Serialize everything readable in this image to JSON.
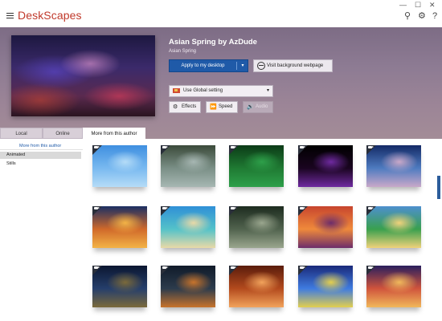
{
  "app": {
    "title": "DeskScapes",
    "window_controls": {
      "minimize": "—",
      "maximize": "☐",
      "close": "✕"
    },
    "toolbar_icons": {
      "search": "⚲",
      "settings": "⚙",
      "help": "?"
    }
  },
  "wallpaper": {
    "title": "Asian Spring by AzDude",
    "subtitle": "Asian Spring",
    "apply_label": "Apply to my desktop",
    "apply_caret": "▾",
    "visit_label": "Visit background webpage",
    "global_setting_label": "Use Global setting",
    "global_setting_caret": "▾",
    "buttons": [
      {
        "label": "Effects",
        "icon": "⚙"
      },
      {
        "label": "Speed",
        "icon": "⏩"
      },
      {
        "label": "Audio",
        "icon": "🔊"
      }
    ]
  },
  "tabs": [
    {
      "label": "Local",
      "active": false
    },
    {
      "label": "Online",
      "active": false
    },
    {
      "label": "More from this author",
      "active": true
    }
  ],
  "sidebar": {
    "header": "More from this author",
    "items": [
      {
        "label": "Animated",
        "selected": true
      },
      {
        "label": "Stills",
        "selected": false
      }
    ]
  },
  "gallery": {
    "rows": [
      [
        {
          "name": "sky-rainbow",
          "badge": "video-camera-icon",
          "colors": [
            "#3f8fe0",
            "#79b9f0",
            "#b5dcf7"
          ]
        },
        {
          "name": "rocky-waterfall",
          "badge": "video-camera-icon",
          "colors": [
            "#3b4a3a",
            "#7a8f86",
            "#a7b7b3"
          ]
        },
        {
          "name": "green-forest",
          "badge": "video-camera-icon",
          "colors": [
            "#0c3b17",
            "#1f7a33",
            "#2ea04a"
          ]
        },
        {
          "name": "eclipse-ring",
          "badge": "video-camera-icon",
          "colors": [
            "#000000",
            "#1a0520",
            "#6f2aa0"
          ]
        },
        {
          "name": "ocean-sunrise",
          "badge": "video-camera-icon",
          "colors": [
            "#142a66",
            "#4e7bc0",
            "#c9a9c9"
          ]
        }
      ],
      [
        {
          "name": "sunset-boats",
          "badge": "video-camera-icon",
          "colors": [
            "#1b2f63",
            "#d0692a",
            "#f3b346"
          ]
        },
        {
          "name": "tropical-beach",
          "badge": "video-camera-icon",
          "colors": [
            "#2f8fd7",
            "#54c2c9",
            "#e9d9a7"
          ]
        },
        {
          "name": "swans-lake",
          "badge": "video-camera-icon",
          "colors": [
            "#1d2b1f",
            "#51634e",
            "#9aa68e"
          ]
        },
        {
          "name": "flower-field",
          "badge": "video-camera-icon",
          "colors": [
            "#c7452e",
            "#ef8a3b",
            "#6d2d6a"
          ]
        },
        {
          "name": "waterfall-rainbow",
          "badge": "video-camera-icon",
          "colors": [
            "#4e8fcf",
            "#39a04e",
            "#f0d27a"
          ]
        }
      ],
      [
        {
          "name": "night-house",
          "badge": "video-camera-icon",
          "colors": [
            "#0b1630",
            "#253e6b",
            "#7b6a3b"
          ]
        },
        {
          "name": "ghost-ship",
          "badge": "video-camera-icon",
          "colors": [
            "#101a29",
            "#2c3b4c",
            "#c8742c"
          ]
        },
        {
          "name": "temple-ruins",
          "badge": "video-camera-icon",
          "colors": [
            "#5a1c0c",
            "#b34a1d",
            "#f2a35c"
          ]
        },
        {
          "name": "crystal-forest",
          "badge": "video-camera-icon",
          "colors": [
            "#1a2a7a",
            "#3f7be0",
            "#e3cf4f"
          ]
        },
        {
          "name": "sunset-clouds",
          "badge": "video-camera-icon",
          "colors": [
            "#2a1f5e",
            "#d0543c",
            "#f1b85b"
          ]
        }
      ]
    ]
  }
}
